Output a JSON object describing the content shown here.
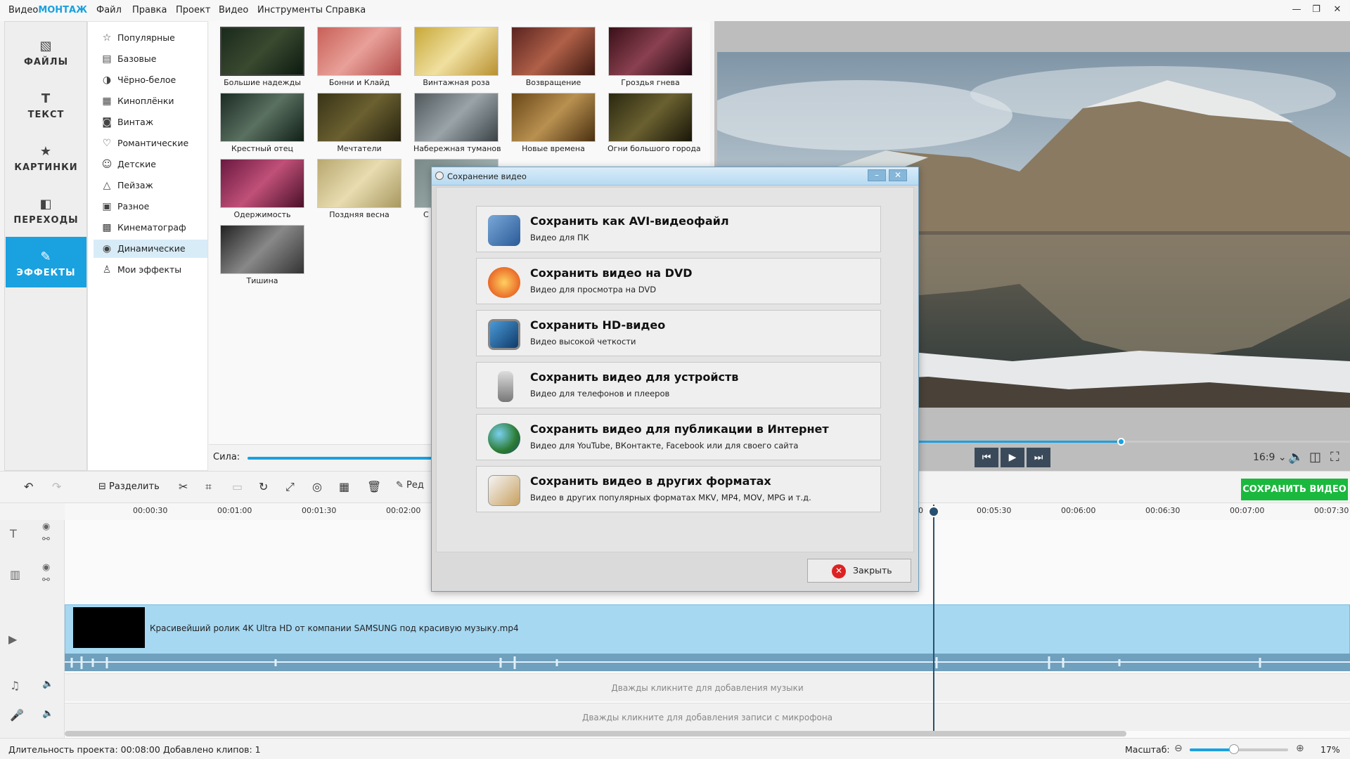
{
  "app": {
    "logo_a": "Видео",
    "logo_b": "МОНТАЖ"
  },
  "menu": [
    "Файл",
    "Правка",
    "Проект",
    "Видео",
    "Инструменты",
    "Справка"
  ],
  "window_controls": [
    "—",
    "❐",
    "✕"
  ],
  "nav": [
    {
      "label": "ФАЙЛЫ",
      "icon": "image-icon"
    },
    {
      "label": "ТЕКСТ",
      "icon": "text-icon"
    },
    {
      "label": "КАРТИНКИ",
      "icon": "star-icon"
    },
    {
      "label": "ПЕРЕХОДЫ",
      "icon": "transitions-icon"
    },
    {
      "label": "ЭФФЕКТЫ",
      "icon": "effects-icon",
      "active": true
    }
  ],
  "categories": [
    "Популярные",
    "Базовые",
    "Чёрно-белое",
    "Киноплёнки",
    "Винтаж",
    "Романтические",
    "Детские",
    "Пейзаж",
    "Разное",
    "Кинематограф",
    "Динамические",
    "Мои эффекты"
  ],
  "selected_category": "Динамические",
  "effects": [
    "Большие надежды",
    "Бонни и Клайд",
    "Винтажная роза",
    "Возвращение",
    "Гроздья гнева",
    "Крестный отец",
    "Мечтатели",
    "Набережная туманов",
    "Новые времена",
    "Огни большого города",
    "Одержимость",
    "Поздняя весна",
    "С",
    "Тишина"
  ],
  "sila_label": "Сила:",
  "preview": {
    "ratio": "16:9"
  },
  "toolbar": {
    "split_label": "Разделить",
    "edit_label": "Ред",
    "save_video": "СОХРАНИТЬ ВИДЕО"
  },
  "timeline": {
    "ticks": [
      "00:00:30",
      "00:01:00",
      "00:01:30",
      "00:02:00",
      "0",
      "00:05:30",
      "00:06:00",
      "00:06:30",
      "00:07:00",
      "00:07:30"
    ],
    "clip_name": "Красивейший ролик 4K Ultra HD от компании SAMSUNG под красивую музыку.mp4",
    "music_hint": "Дважды кликните для добавления музыки",
    "mic_hint": "Дважды кликните для добавления записи с микрофона"
  },
  "status": {
    "duration": "Длительность проекта: 00:08:00",
    "clips": "Добавлено клипов: 1",
    "zoom_label": "Масштаб:",
    "zoom_pct": "17%",
    "zoom_level": 0.45
  },
  "dialog": {
    "title": "Сохранение видео",
    "options": [
      {
        "title": "Сохранить как AVI-видеофайл",
        "subtitle": "Видео для ПК",
        "icon": "avi-icon"
      },
      {
        "title": "Сохранить видео на DVD",
        "subtitle": "Видео для просмотра на DVD",
        "icon": "dvd-icon"
      },
      {
        "title": "Сохранить HD-видео",
        "subtitle": "Видео высокой четкости",
        "icon": "monitor-icon"
      },
      {
        "title": "Сохранить видео для устройств",
        "subtitle": "Видео для телефонов и плееров",
        "icon": "phone-icon"
      },
      {
        "title": "Сохранить видео для публикации в Интернет",
        "subtitle": "Видео для YouTube, ВКонтакте, Facebook или для своего сайта",
        "icon": "globe-icon"
      },
      {
        "title": "Сохранить видео в других форматах",
        "subtitle": "Видео в других популярных форматах MKV, MP4, MOV, MPG и т.д.",
        "icon": "film-reel-icon"
      }
    ],
    "close_label": "Закрыть"
  },
  "colors": {
    "accent": "#1aa1e0",
    "save_green": "#1ab93d",
    "clip": "#a6d8f2"
  }
}
